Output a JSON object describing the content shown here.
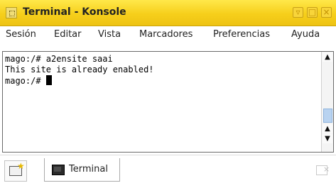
{
  "window": {
    "title": "Terminal - Konsole",
    "buttons": {
      "minimize": "▿",
      "maximize": "□",
      "close": "×"
    }
  },
  "menu": {
    "items": [
      "Sesión",
      "Editar",
      "Vista",
      "Marcadores",
      "Preferencias",
      "Ayuda"
    ]
  },
  "terminal": {
    "lines": [
      "mago:/# a2ensite saai",
      "This site is already enabled!",
      "mago:/# "
    ],
    "scroll_icons": {
      "up": "▲",
      "up2": "▲",
      "down": "▼"
    }
  },
  "tabs": {
    "items": [
      {
        "label": "Terminal"
      }
    ]
  },
  "icons": {
    "new_tab": "new-session-icon",
    "close_tab": "close-session-icon",
    "terminal": "terminal-icon"
  }
}
